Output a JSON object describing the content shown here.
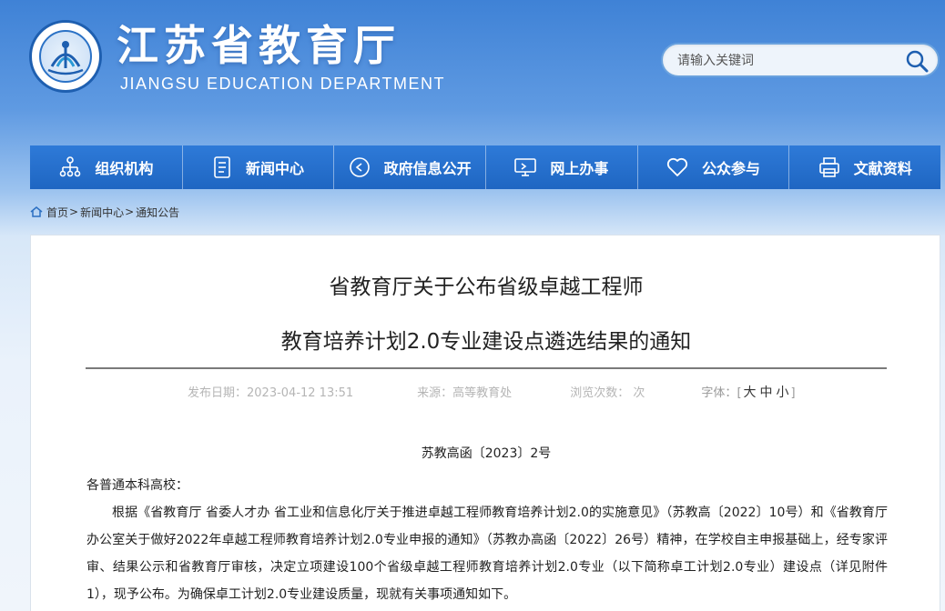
{
  "header": {
    "title": "江苏省教育厅",
    "subtitle": "JIANGSU EDUCATION DEPARTMENT",
    "logo_icon": "education-seal-logo",
    "search": {
      "placeholder": "请输入关键词",
      "value": "",
      "icon": "search-icon"
    }
  },
  "nav": {
    "items": [
      {
        "label": "组织机构",
        "icon": "org-chart-icon"
      },
      {
        "label": "新闻中心",
        "icon": "document-icon"
      },
      {
        "label": "政府信息公开",
        "icon": "disclosure-icon"
      },
      {
        "label": "网上办事",
        "icon": "monitor-icon"
      },
      {
        "label": "公众参与",
        "icon": "heart-icon"
      },
      {
        "label": "文献资料",
        "icon": "printer-icon"
      }
    ]
  },
  "breadcrumb": {
    "home_icon": "home-icon",
    "items": [
      "首页",
      "新闻中心",
      "通知公告"
    ],
    "separator": ">"
  },
  "article": {
    "title_line1": "省教育厅关于公布省级卓越工程师",
    "title_line2": "教育培养计划2.0专业建设点遴选结果的通知",
    "meta": {
      "publish": "发布日期：2023-04-12 13:51",
      "source": "来源：高等教育处",
      "views": "浏览次数：  次",
      "font_label": "字体：",
      "font_open": "[",
      "font_large": "大",
      "font_medium": "中",
      "font_small": "小",
      "font_close": "]"
    },
    "doc_number": "苏教高函〔2023〕2号",
    "salutation": "各普通本科高校：",
    "paragraph": "根据《省教育厅 省委人才办 省工业和信息化厅关于推进卓越工程师教育培养计划2.0的实施意见》（苏教高〔2022〕10号）和《省教育厅办公室关于做好2022年卓越工程师教育培养计划2.0专业申报的通知》（苏教办高函〔2022〕26号）精神，在学校自主申报基础上，经专家评审、结果公示和省教育厅审核，决定立项建设100个省级卓越工程师教育培养计划2.0专业（以下简称卓工计划2.0专业）建设点（详见附件1），现予公布。为确保卓工计划2.0专业建设质量，现就有关事项通知如下。"
  },
  "colors": {
    "nav_bg": "#1f66c2",
    "header_bg": "#3f82d6",
    "text": "#222222",
    "meta_text": "#b5b5b5"
  }
}
